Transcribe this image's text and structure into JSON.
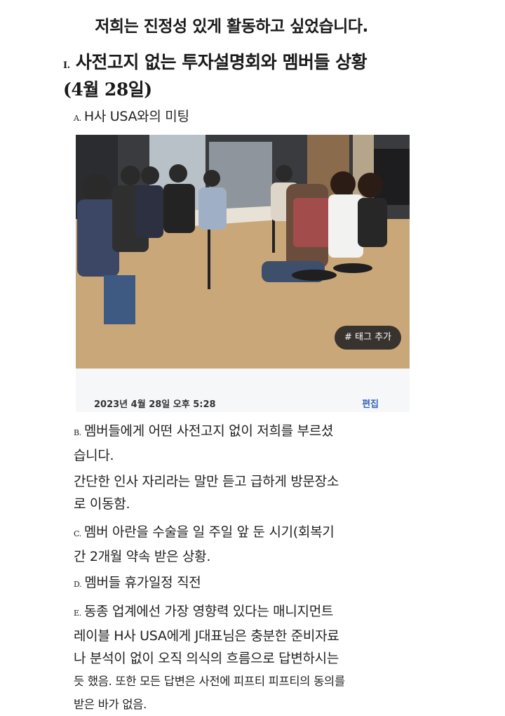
{
  "page_title": "저희는 진정성 있게 활동하고 싶었습니다.",
  "section": {
    "number": "I.",
    "title": "사전고지 없는 투자설명회와 멤버들 상황",
    "date": "(4월 28일)"
  },
  "items": {
    "a": {
      "marker": "A.",
      "text": "H사 USA와의 미팅"
    },
    "b": {
      "marker": "B.",
      "line1": "멤버들에게 어떤 사전고지 없이 저희를 부르셨",
      "line2": "습니다."
    },
    "b_extra": {
      "line1": "간단한 인사 자리라는 말만 듣고 급하게 방문장소",
      "line2": "로 이동함."
    },
    "c": {
      "marker": "C.",
      "line1": "멤버 아란을 수술을 일 주일 앞 둔 시기(회복기",
      "line2": "간 2개월 약속 받은 상황."
    },
    "d": {
      "marker": "D.",
      "text": "멤버들 휴가일정 직전"
    },
    "e": {
      "marker": "E.",
      "line1": "동종 업계에선 가장 영향력 있다는 매니지먼트",
      "line2": "레이블 H사 USA에게 J대표님은 충분한 준비자료",
      "line3": "나 분석이 없이 오직 의식의 흐름으로 답변하시는",
      "line4": "듯 했음. 또한 모든 답변은 사전에 피프티 피프티의 동의를",
      "line5": "받은 바가 없음."
    }
  },
  "photo": {
    "tag_button": "# 태그 추가",
    "timestamp": "2023년 4월 28일 오후 5:28",
    "edit_label": "편집"
  }
}
